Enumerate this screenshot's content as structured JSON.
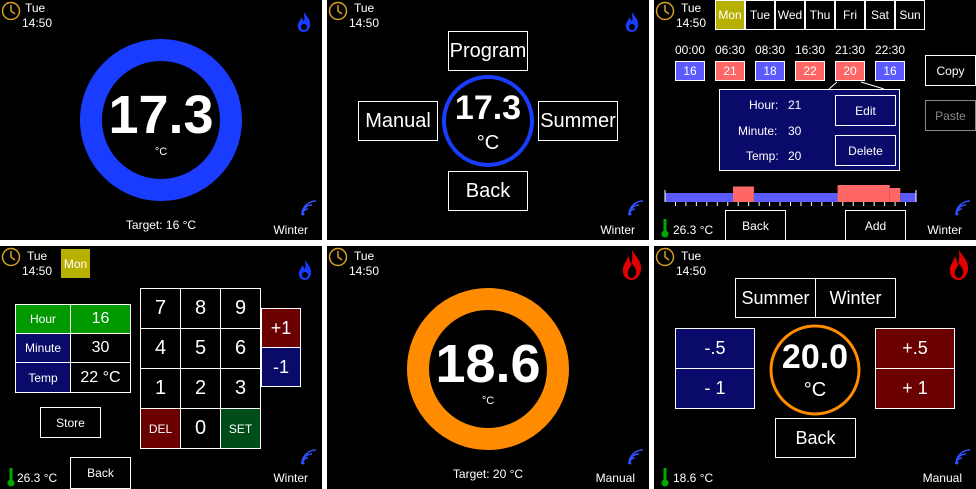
{
  "colors": {
    "blue_ring": "#1a3cff",
    "orange_ring": "#ff8c00",
    "cold_block": "#5a5aff",
    "hot_block": "#ff6666",
    "navy": "#0a0a6a",
    "maroon": "#6a0000",
    "green": "#009900",
    "olive": "#b8b000"
  },
  "p1": {
    "day": "Tue",
    "time": "14:50",
    "temp": "17.3",
    "unit": "°C",
    "target": "Target: 16 °C",
    "mode": "Winter"
  },
  "p2": {
    "day": "Tue",
    "time": "14:50",
    "temp": "17.3",
    "unit": "°C",
    "program": "Program",
    "manual": "Manual",
    "summer": "Summer",
    "back": "Back",
    "mode": "Winter"
  },
  "p3": {
    "day": "Tue",
    "time": "14:50",
    "days": [
      "Mon",
      "Tue",
      "Wed",
      "Thu",
      "Fri",
      "Sat",
      "Sun"
    ],
    "slots": [
      {
        "time": "00:00",
        "temp": "16",
        "kind": "cold"
      },
      {
        "time": "06:30",
        "temp": "21",
        "kind": "hot"
      },
      {
        "time": "08:30",
        "temp": "18",
        "kind": "cold"
      },
      {
        "time": "16:30",
        "temp": "22",
        "kind": "hot"
      },
      {
        "time": "21:30",
        "temp": "20",
        "kind": "hot"
      },
      {
        "time": "22:30",
        "temp": "16",
        "kind": "cold"
      }
    ],
    "copy": "Copy",
    "paste": "Paste",
    "hour_label": "Hour:",
    "hour_value": "21",
    "minute_label": "Minute:",
    "minute_value": "30",
    "temp_label": "Temp:",
    "temp_value": "20",
    "edit": "Edit",
    "delete": "Delete",
    "room_temp": "26.3 °C",
    "back": "Back",
    "add": "Add",
    "mode": "Winter"
  },
  "p4": {
    "day": "Tue",
    "time": "14:50",
    "selected_day": "Mon",
    "hour_label": "Hour",
    "hour_value": "16",
    "minute_label": "Minute",
    "minute_value": "30",
    "temp_label": "Temp",
    "temp_value": "22 °C",
    "store": "Store",
    "keys": [
      "7",
      "8",
      "9",
      "4",
      "5",
      "6",
      "1",
      "2",
      "3"
    ],
    "del": "DEL",
    "zero": "0",
    "set": "SET",
    "plus": "+1",
    "minus": "-1",
    "room_temp": "26.3 °C",
    "back": "Back",
    "mode": "Winter"
  },
  "p5": {
    "day": "Tue",
    "time": "14:50",
    "temp": "18.6",
    "unit": "°C",
    "target": "Target: 20 °C",
    "mode": "Manual"
  },
  "p6": {
    "day": "Tue",
    "time": "14:50",
    "summer": "Summer",
    "winter": "Winter",
    "dec_half": "-.5",
    "dec_one": "- 1",
    "inc_half": "+.5",
    "inc_one": "+ 1",
    "temp": "20.0",
    "unit": "°C",
    "back": "Back",
    "room_temp": "18.6 °C",
    "mode": "Manual"
  }
}
